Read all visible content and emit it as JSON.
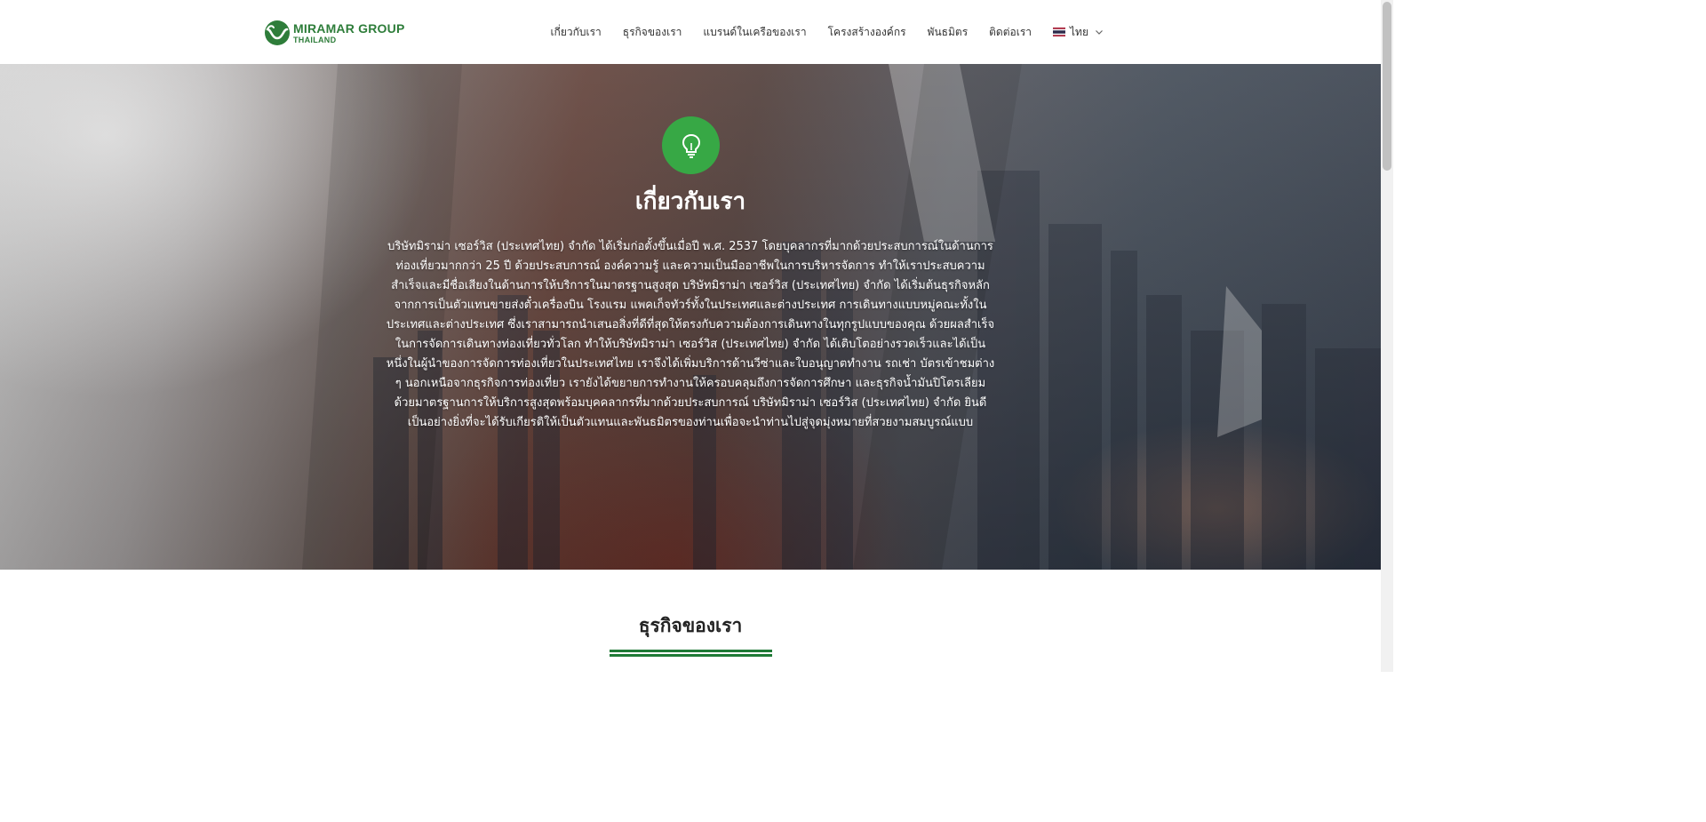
{
  "brand": {
    "name_line1": "MIRAMAR GROUP",
    "name_line2": "THAILAND",
    "color": "#2e7d3a"
  },
  "nav": {
    "items": [
      {
        "label": "เกี่ยวกับเรา"
      },
      {
        "label": "ธุรกิจของเรา"
      },
      {
        "label": "แบรนด์ในเครือของเรา"
      },
      {
        "label": "โครงสร้างองค์กร"
      },
      {
        "label": "พันธมิตร"
      },
      {
        "label": "ติดต่อเรา"
      }
    ],
    "language": {
      "label": "ไทย",
      "icon": "thai-flag-icon"
    }
  },
  "hero": {
    "icon": "lightbulb-icon",
    "icon_color": "#37a845",
    "title": "เกี่ยวกับเรา",
    "body": "บริษัทมิราม่า เซอร์วิส (ประเทศไทย) จำกัด ได้เริ่มก่อตั้งขึ้นเมื่อปี พ.ศ. 2537 โดยบุคลากรที่มากด้วยประสบการณ์ในด้านการท่องเที่ยวมากกว่า 25 ปี ด้วยประสบการณ์ องค์ความรู้ และความเป็นมืออาชีพในการบริหารจัดการ ทำให้เราประสบความสำเร็จและมีชื่อเสียงในด้านการให้บริการในมาตรฐานสูงสุด บริษัทมิราม่า เซอร์วิส (ประเทศไทย) จำกัด ได้เริ่มต้นธุรกิจหลักจากการเป็นตัวแทนขายส่งตั๋วเครื่องบิน โรงแรม แพคเก็จทัวร์ทั้งในประเทศและต่างประเทศ การเดินทางแบบหมู่คณะทั้งในประเทศและต่างประเทศ ซึ่งเราสามารถนำเสนอสิ่งที่ดีที่สุดให้ตรงกับความต้องการเดินทางในทุกรูปแบบของคุณ ด้วยผลสำเร็จในการจัดการเดินทางท่องเที่ยวทั่วโลก ทำให้บริษัทมิราม่า เซอร์วิส (ประเทศไทย) จำกัด ได้เติบโตอย่างรวดเร็วและได้เป็นหนึ่งในผู้นำของการจัดการท่องเที่ยวในประเทศไทย เราจึงได้เพิ่มบริการด้านวีซ่าและใบอนุญาตทำงาน รถเช่า บัตรเข้าชมต่าง ๆ นอกเหนือจากธุรกิจการท่องเที่ยว เรายังได้ขยายการทำงานให้ครอบคลุมถึงการจัดการศึกษา และธุรกิจน้ำมันปิโตรเลียมด้วยมาตรฐานการให้บริการสูงสุดพร้อมบุคคลากรที่มากด้วยประสบการณ์ บริษัทมิราม่า เซอร์วิส (ประเทศไทย) จำกัด ยินดีเป็นอย่างยิ่งที่จะได้รับเกียรติให้เป็นตัวแทนและพันธมิตรของท่านเพื่อจะนำท่านไปสู่จุดมุ่งหมายที่สวยงามสมบูรณ์แบบ"
  },
  "business": {
    "title": "ธุรกิจของเรา",
    "underline_color": "#1f7a36"
  }
}
